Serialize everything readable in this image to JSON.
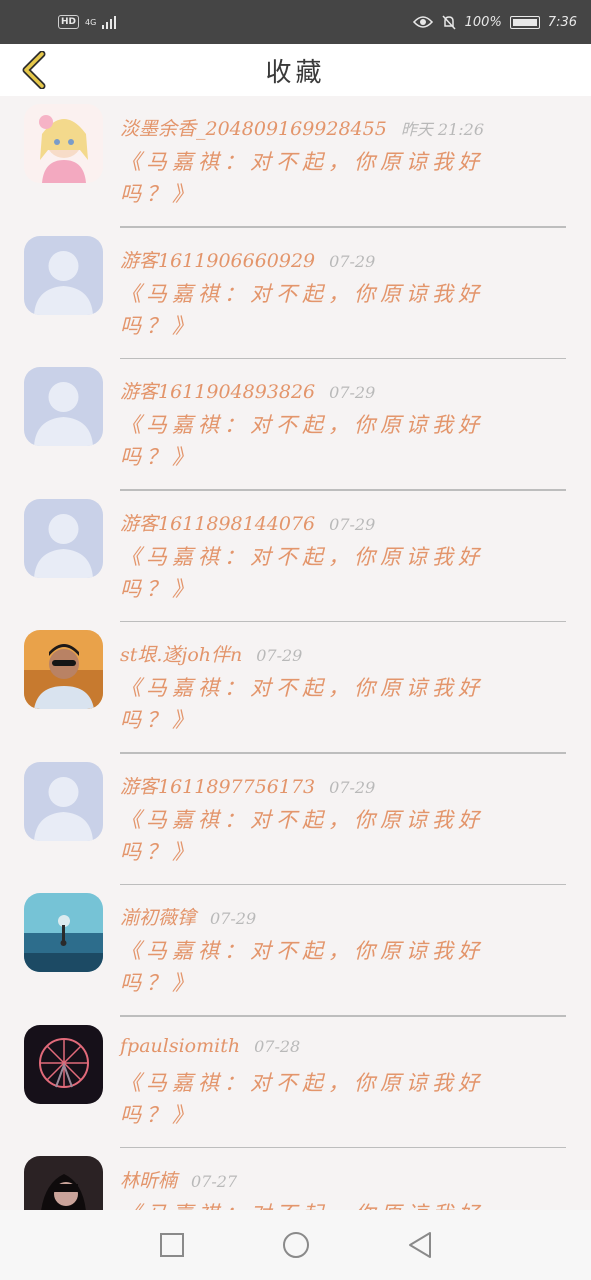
{
  "status_bar": {
    "hd_label": "HD",
    "network_label": "4G",
    "battery_percent": "100%",
    "time": "7:36"
  },
  "header": {
    "title": "收藏"
  },
  "favorites": [
    {
      "username": "淡墨余香_204809169928455",
      "time": "昨天 21:26",
      "content": "《马嘉祺：对不起，你原谅我好吗？》",
      "avatar": "anime-girl"
    },
    {
      "username": "游客1611906660929",
      "time": "07-29",
      "content": "《马嘉祺：对不起，你原谅我好吗？》",
      "avatar": "default"
    },
    {
      "username": "游客1611904893826",
      "time": "07-29",
      "content": "《马嘉祺：对不起，你原谅我好吗？》",
      "avatar": "default"
    },
    {
      "username": "游客1611898144076",
      "time": "07-29",
      "content": "《马嘉祺：对不起，你原谅我好吗？》",
      "avatar": "default"
    },
    {
      "username": "st垠.遂joh伴n",
      "time": "07-29",
      "content": "《马嘉祺：对不起，你原谅我好吗？》",
      "avatar": "man-sunglasses"
    },
    {
      "username": "游客1611897756173",
      "time": "07-29",
      "content": "《马嘉祺：对不起，你原谅我好吗？》",
      "avatar": "default"
    },
    {
      "username": "湔初薇镎",
      "time": "07-29",
      "content": "《马嘉祺：对不起，你原谅我好吗？》",
      "avatar": "sea"
    },
    {
      "username": "fpaulsiomith",
      "time": "07-28",
      "content": "《马嘉祺：对不起，你原谅我好吗？》",
      "avatar": "ferris-wheel"
    },
    {
      "username": "林昕楠",
      "time": "07-27",
      "content": "《马嘉祺：对不起，你原谅我好吗？》",
      "avatar": "dark-girl"
    }
  ],
  "nav": {
    "icons": [
      "square-icon",
      "circle-icon",
      "triangle-back-icon"
    ]
  }
}
